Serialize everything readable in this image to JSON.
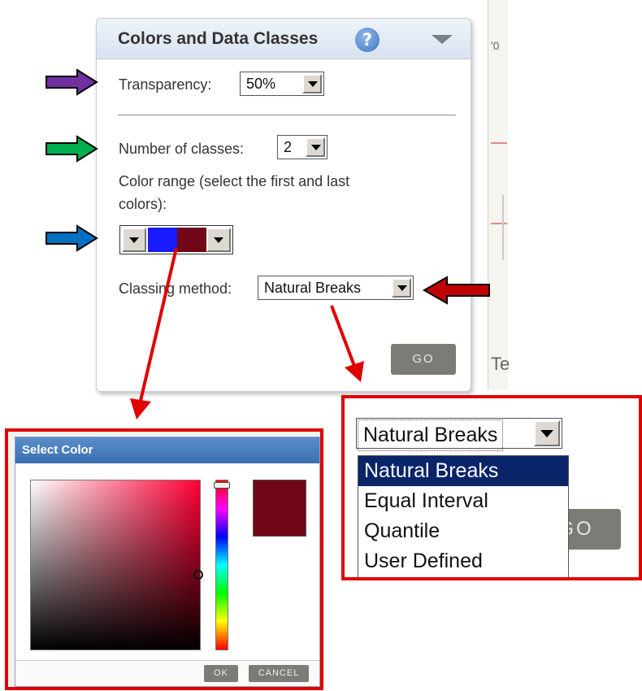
{
  "panel": {
    "title": "Colors and Data Classes",
    "help_icon": "question-mark-icon",
    "collapse_icon": "triangle-down-icon",
    "transparency_label": "Transparency:",
    "transparency_value": "50%",
    "classes_label": "Number of classes:",
    "classes_value": "2",
    "color_range_label_1": "Color range (select the first and last",
    "color_range_label_2": "colors):",
    "first_color": "#1a1aff",
    "last_color": "#700818",
    "classing_label": "Classing method:",
    "classing_value": "Natural Breaks",
    "go_label": "GO"
  },
  "arrows": {
    "transparency_color": "#7030a0",
    "classes_color": "#00b050",
    "color_range_color": "#0070c0",
    "classing_color": "#c00000",
    "callout_color": "#e00000"
  },
  "map": {
    "text_1": "Te",
    "text_2": "'0"
  },
  "color_picker": {
    "title": "Select Color",
    "preview_color": "#700818",
    "ok_label": "OK",
    "cancel_label": "CANCEL"
  },
  "classing_dropdown": {
    "current": "Natural Breaks",
    "go_label": "GO",
    "options": [
      "Natural Breaks",
      "Equal Interval",
      "Quantile",
      "User Defined"
    ]
  }
}
